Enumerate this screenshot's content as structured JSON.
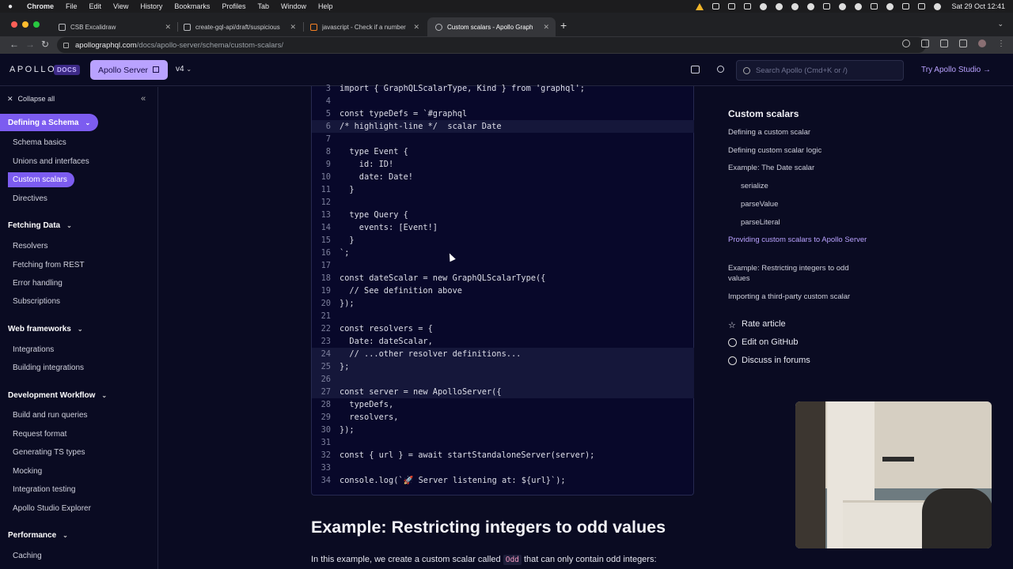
{
  "menubar": {
    "app": "Chrome",
    "menus": [
      "File",
      "Edit",
      "View",
      "History",
      "Bookmarks",
      "Profiles",
      "Tab",
      "Window",
      "Help"
    ],
    "clock": "Sat 29 Oct 12:41"
  },
  "tabs": [
    {
      "title": "CSB Excalidraw"
    },
    {
      "title": "create-gql-api/draft/suspicious"
    },
    {
      "title": "javascript - Check if a number"
    },
    {
      "title": "Custom scalars - Apollo Graph"
    }
  ],
  "address": {
    "host": "apollographql.com",
    "path": "/docs/apollo-server/schema/custom-scalars/"
  },
  "header": {
    "logo": "APOLLO",
    "docs_badge": "DOCS",
    "product": "Apollo Server",
    "version": "v4",
    "search_placeholder": "Search Apollo (Cmd+K or /)",
    "try_studio": "Try Apollo Studio →"
  },
  "sidebar": {
    "collapse_all": "Collapse all",
    "sections": [
      {
        "label": "Defining a Schema",
        "items": [
          "Schema basics",
          "Unions and interfaces",
          "Custom scalars",
          "Directives"
        ]
      },
      {
        "label": "Fetching Data",
        "items": [
          "Resolvers",
          "Fetching from REST",
          "Error handling",
          "Subscriptions"
        ]
      },
      {
        "label": "Web frameworks",
        "items": [
          "Integrations",
          "Building integrations"
        ]
      },
      {
        "label": "Development Workflow",
        "items": [
          "Build and run queries",
          "Request format",
          "Generating TS types",
          "Mocking",
          "Integration testing",
          "Apollo Studio Explorer"
        ]
      },
      {
        "label": "Performance",
        "items": [
          "Caching"
        ]
      }
    ]
  },
  "code": [
    {
      "n": "3",
      "t": "import { GraphQLScalarType, Kind } from 'graphql';"
    },
    {
      "n": "4",
      "t": ""
    },
    {
      "n": "5",
      "t": "const typeDefs = `#graphql"
    },
    {
      "n": "6",
      "t": "/* highlight-line */  scalar Date"
    },
    {
      "n": "7",
      "t": ""
    },
    {
      "n": "8",
      "t": "  type Event {"
    },
    {
      "n": "9",
      "t": "    id: ID!"
    },
    {
      "n": "10",
      "t": "    date: Date!"
    },
    {
      "n": "11",
      "t": "  }"
    },
    {
      "n": "12",
      "t": ""
    },
    {
      "n": "13",
      "t": "  type Query {"
    },
    {
      "n": "14",
      "t": "    events: [Event!]"
    },
    {
      "n": "15",
      "t": "  }"
    },
    {
      "n": "16",
      "t": "`;"
    },
    {
      "n": "17",
      "t": ""
    },
    {
      "n": "18",
      "t": "const dateScalar = new GraphQLScalarType({"
    },
    {
      "n": "19",
      "t": "  // See definition above"
    },
    {
      "n": "20",
      "t": "});"
    },
    {
      "n": "21",
      "t": ""
    },
    {
      "n": "22",
      "t": "const resolvers = {"
    },
    {
      "n": "23",
      "t": "  Date: dateScalar,"
    },
    {
      "n": "24",
      "t": "  // ...other resolver definitions..."
    },
    {
      "n": "25",
      "t": "};"
    },
    {
      "n": "26",
      "t": ""
    },
    {
      "n": "27",
      "t": "const server = new ApolloServer({"
    },
    {
      "n": "28",
      "t": "  typeDefs,"
    },
    {
      "n": "29",
      "t": "  resolvers,"
    },
    {
      "n": "30",
      "t": "});"
    },
    {
      "n": "31",
      "t": ""
    },
    {
      "n": "32",
      "t": "const { url } = await startStandaloneServer(server);"
    },
    {
      "n": "33",
      "t": ""
    },
    {
      "n": "34",
      "t": "console.log(`🚀 Server listening at: ${url}`);"
    }
  ],
  "article": {
    "heading": "Example: Restricting integers to odd values",
    "para_before": "In this example, we create a custom scalar called ",
    "para_code": "Odd",
    "para_after": " that can only contain odd integers:"
  },
  "toc": {
    "title": "Custom scalars",
    "items": [
      "Defining a custom scalar",
      "Defining custom scalar logic",
      "Example: The Date scalar",
      "serialize",
      "parseValue",
      "parseLiteral",
      "Providing custom scalars to Apollo Server",
      "Example: Restricting integers to odd values",
      "Importing a third-party custom scalar"
    ],
    "links": [
      "Rate article",
      "Edit on GitHub",
      "Discuss in forums"
    ]
  },
  "colors": {
    "accent": "#7c5cf0",
    "accent_light": "#b9a2ff",
    "background": "#0a0b22",
    "code_bg": "#08082a",
    "comment": "#f2a24a"
  }
}
